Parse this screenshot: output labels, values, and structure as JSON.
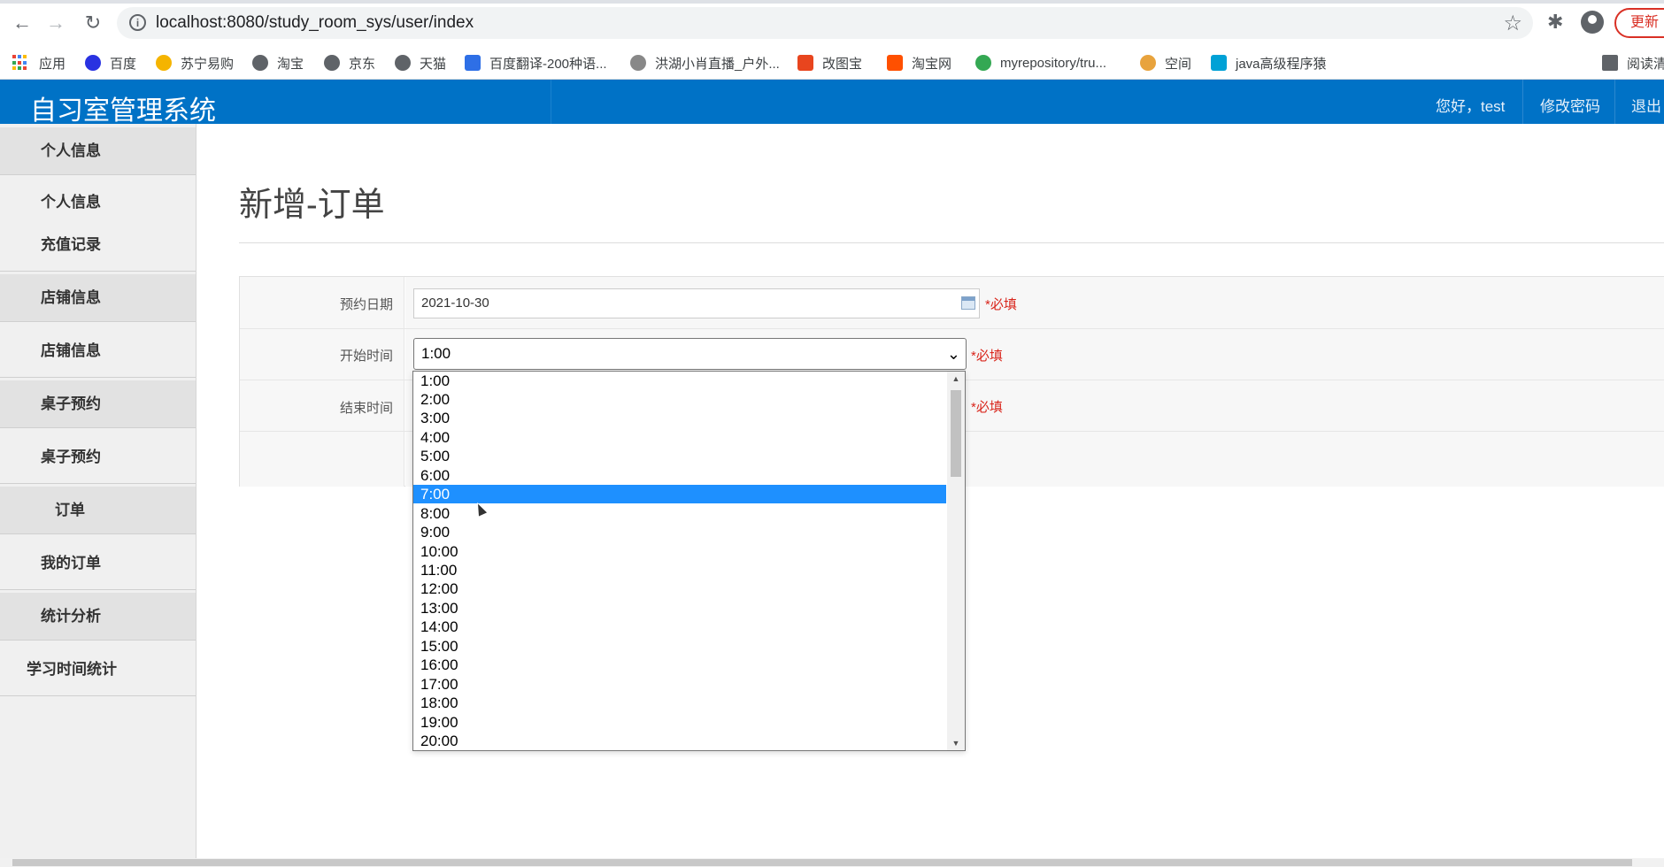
{
  "browser": {
    "url": "localhost:8080/study_room_sys/user/index",
    "update_label": "更新",
    "bookmarks": [
      {
        "label": "应用",
        "color": "#ea4335"
      },
      {
        "label": "百度",
        "color": "#2932e1"
      },
      {
        "label": "苏宁易购",
        "color": "#f5b400"
      },
      {
        "label": "淘宝",
        "color": "#5f6368"
      },
      {
        "label": "京东",
        "color": "#5f6368"
      },
      {
        "label": "天猫",
        "color": "#5f6368"
      },
      {
        "label": "百度翻译-200种语...",
        "color": "#2e6fe6"
      },
      {
        "label": "洪湖小肖直播_户外...",
        "color": "#888888"
      },
      {
        "label": "改图宝",
        "color": "#e8451e"
      },
      {
        "label": "淘宝网",
        "color": "#ff5000"
      },
      {
        "label": "myrepository/tru...",
        "color": "#34a853"
      },
      {
        "label": "空间",
        "color": "#e8a33d"
      },
      {
        "label": "java高级程序猿",
        "color": "#00a1d6"
      },
      {
        "label": "阅读清",
        "color": "#5f6368"
      }
    ]
  },
  "header": {
    "title": "自习室管理系统",
    "greeting": "您好，test",
    "change_password": "修改密码",
    "logout": "退出"
  },
  "sidebar": {
    "groups": [
      {
        "label": "个人信息",
        "items": [
          "个人信息",
          "充值记录"
        ]
      },
      {
        "label": "店铺信息",
        "items": [
          "店铺信息"
        ]
      },
      {
        "label": "桌子预约",
        "items": [
          "桌子预约"
        ]
      },
      {
        "label": "订单",
        "items": [
          "我的订单"
        ]
      },
      {
        "label": "统计分析",
        "items": [
          "学习时间统计"
        ]
      }
    ]
  },
  "main": {
    "page_title": "新增-订单",
    "form": {
      "date_label": "预约日期",
      "date_value": "2021-10-30",
      "start_label": "开始时间",
      "start_value": "1:00",
      "end_label": "结束时间",
      "required": "*必填"
    },
    "dropdown": {
      "options": [
        "1:00",
        "2:00",
        "3:00",
        "4:00",
        "5:00",
        "6:00",
        "7:00",
        "8:00",
        "9:00",
        "10:00",
        "11:00",
        "12:00",
        "13:00",
        "14:00",
        "15:00",
        "16:00",
        "17:00",
        "18:00",
        "19:00",
        "20:00"
      ],
      "highlighted": "7:00"
    }
  },
  "colors": {
    "header_bg": "#0072c6",
    "highlight": "#1e90ff",
    "required": "#d9261c"
  }
}
